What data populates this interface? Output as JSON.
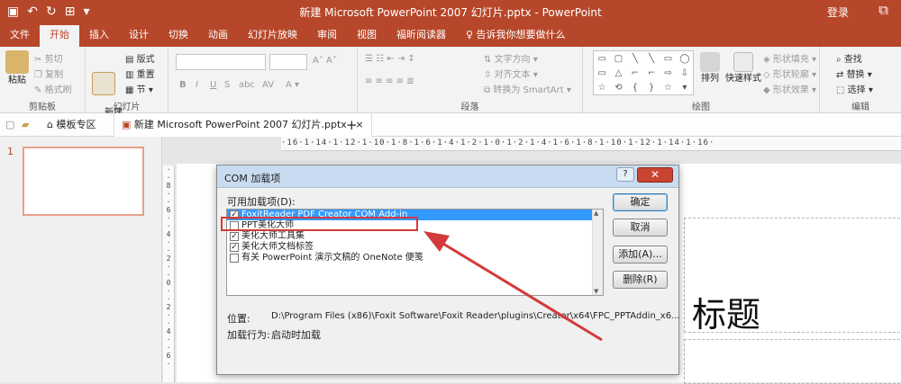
{
  "titlebar": {
    "title": "新建 Microsoft PowerPoint 2007 幻灯片.pptx  -  PowerPoint",
    "login": "登录",
    "restore": "⧉"
  },
  "tabs": [
    "文件",
    "开始",
    "插入",
    "设计",
    "切换",
    "动画",
    "幻灯片放映",
    "审阅",
    "视图",
    "福昕阅读器",
    "♀ 告诉我你想要做什么"
  ],
  "ribbon": {
    "clipboard": {
      "label": "剪贴板",
      "paste": "粘贴",
      "cut": "剪切",
      "copy": "复制",
      "format_painter": "格式刷"
    },
    "slides": {
      "label": "幻灯片",
      "new_slide": "新建\n幻灯片",
      "layout": "版式",
      "reset": "重置",
      "section": "节"
    },
    "font": {
      "bold": "B",
      "italic": "I",
      "underline": "U",
      "strike": "S",
      "shadow": "abc",
      "spacing": "AV"
    },
    "paragraph": {
      "label": "段落",
      "text_direction": "文字方向",
      "align_text": "对齐文本",
      "smartart": "转换为 SmartArt"
    },
    "drawing": {
      "label": "绘图",
      "arrange": "排列",
      "quick_styles": "快速样式",
      "shape_fill": "形状填充",
      "shape_outline": "形状轮廓",
      "shape_effects": "形状效果"
    },
    "editing": {
      "label": "编辑",
      "find": "查找",
      "replace": "替换",
      "select": "选择"
    }
  },
  "doctabs": {
    "templates": "模板专区",
    "document": "新建 Microsoft PowerPoint 2007 幻灯片.pptx",
    "close": "×",
    "add": "+"
  },
  "slide_pane": {
    "number": "1"
  },
  "rulers": {
    "horizontal": "·16·1·14·1·12·1·10·1·8·1·6·1·4·1·2·1·0·1·2·1·4·1·6·1·8·1·10·1·12·1·14·1·16·",
    "vertical": "·\n·\n8\n·\n·\n6\n·\n·\n4\n·\n·\n2\n·\n·\n0\n·\n·\n2\n·\n·\n4\n·\n·\n6\n·"
  },
  "slide": {
    "title_partial": "标题"
  },
  "dialog": {
    "title": "COM 加载项",
    "help": "?",
    "close": "✕",
    "available_label": "可用加载项(D):",
    "items": [
      {
        "label": "FoxitReader PDF Creator COM Add-in",
        "checked": true,
        "selected": true
      },
      {
        "label": "PPT美化大师",
        "checked": false,
        "selected": false
      },
      {
        "label": "美化大师工具集",
        "checked": true,
        "selected": false
      },
      {
        "label": "美化大师文档标签",
        "checked": true,
        "selected": false
      },
      {
        "label": "有关 PowerPoint 演示文稿的 OneNote 便笺",
        "checked": false,
        "selected": false
      }
    ],
    "location_label": "位置:",
    "location_value": "D:\\Program Files (x86)\\Foxit Software\\Foxit Reader\\plugins\\Creator\\x64\\FPC_PPTAddin_x6...",
    "load_behavior_label": "加载行为:",
    "load_behavior_value": "启动时加载",
    "buttons": {
      "ok": "确定",
      "cancel": "取消",
      "add": "添加(A)...",
      "remove": "删除(R)"
    }
  },
  "colors": {
    "accent": "#b7472a",
    "selection": "#3399ff",
    "annotation": "#d23b3b"
  }
}
